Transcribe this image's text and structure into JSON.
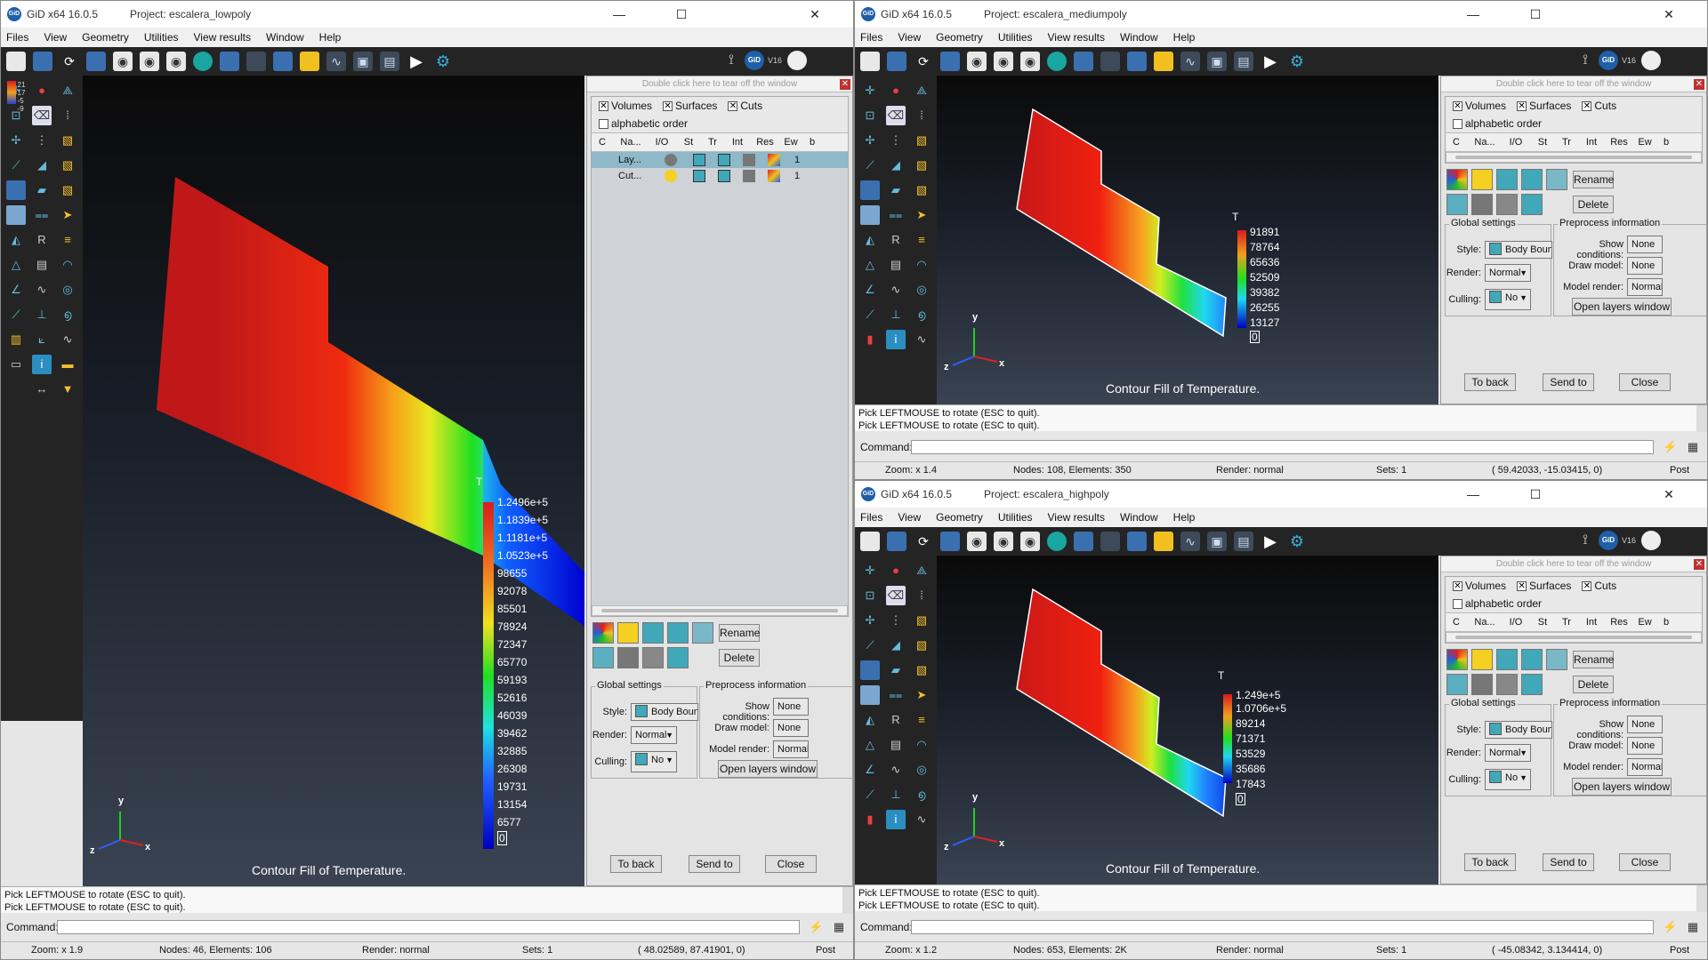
{
  "app_name": "GiD x64 16.0.5",
  "window_controls": {
    "minimize": "—",
    "maximize": "☐",
    "close": "✕"
  },
  "menu": [
    "Files",
    "View",
    "Geometry",
    "Utilities",
    "View results",
    "Window",
    "Help"
  ],
  "gid_badge": "GiD",
  "gid_version": "V16",
  "layers_panel": {
    "tear_text": "Double click here to tear off the window",
    "close_x": "✕",
    "checks": {
      "volumes": "Volumes",
      "surfaces": "Surfaces",
      "cuts": "Cuts",
      "alphabetic": "alphabetic order"
    },
    "columns": [
      "C",
      "Na...",
      "I/O",
      "St",
      "Tr",
      "Int",
      "Res",
      "Ew",
      "b"
    ],
    "rows_lowpoly": [
      {
        "name": "Lay...",
        "value": "1"
      },
      {
        "name": "Cut...",
        "value": "1"
      }
    ],
    "rename": "Rename",
    "delete": "Delete",
    "global_settings": "Global settings",
    "preprocess_info": "Preprocess information",
    "style_label": "Style:",
    "style_value": "Body Bound",
    "render_label": "Render:",
    "render_value": "Normal",
    "culling_label": "Culling:",
    "culling_value": "No",
    "show_conditions_label": "Show conditions:",
    "show_conditions_value": "None",
    "draw_model_label": "Draw model:",
    "draw_model_value": "None",
    "model_render_label": "Model render:",
    "model_render_value": "Normal",
    "open_layers": "Open layers window",
    "to_back": "To back",
    "send_to": "Send to",
    "close": "Close"
  },
  "status_lines": [
    "Pick LEFTMOUSE to rotate (ESC to quit).",
    "Pick LEFTMOUSE to rotate (ESC to quit)."
  ],
  "command_label": "Command:",
  "contour_label": "Contour Fill of Temperature.",
  "axis_labels": {
    "x": "x",
    "y": "y",
    "z": "z"
  },
  "windows": {
    "lowpoly": {
      "project": "Project: escalera_lowpoly",
      "legend_title": "T",
      "legend_values": [
        "1.2496e+5",
        "1.1839e+5",
        "1.1181e+5",
        "1.0523e+5",
        "98655",
        "92078",
        "85501",
        "78924",
        "72347",
        "65770",
        "59193",
        "52616",
        "46039",
        "39462",
        "32885",
        "26308",
        "19731",
        "13154",
        "6577",
        "0"
      ],
      "statusbar": {
        "zoom": "Zoom: x 1.9",
        "nodes": "Nodes: 46, Elements: 106",
        "render": "Render: normal",
        "sets": "Sets: 1",
        "coords": "( 48.02589, 87.41901, 0)",
        "mode": "Post"
      }
    },
    "mediumpoly": {
      "project": "Project: escalera_mediumpoly",
      "legend_title": "T",
      "legend_values": [
        "91891",
        "78764",
        "65636",
        "52509",
        "39382",
        "26255",
        "13127",
        "0"
      ],
      "statusbar": {
        "zoom": "Zoom: x 1.4",
        "nodes": "Nodes: 108, Elements: 350",
        "render": "Render: normal",
        "sets": "Sets: 1",
        "coords": "( 59.42033, -15.03415, 0)",
        "mode": "Post"
      }
    },
    "highpoly": {
      "project": "Project: escalera_highpoly",
      "legend_title": "T",
      "legend_values": [
        "1.249e+5",
        "1.0706e+5",
        "89214",
        "71371",
        "53529",
        "35686",
        "17843",
        "0"
      ],
      "statusbar": {
        "zoom": "Zoom: x 1.2",
        "nodes": "Nodes: 653, Elements: 2K",
        "render": "Render: normal",
        "sets": "Sets: 1",
        "coords": "( -45.08342, 3.134414, 0)",
        "mode": "Post"
      }
    }
  },
  "side_legend": [
    "21",
    "17",
    "-5",
    "-9"
  ],
  "colors": {
    "hot": "#d81c1c",
    "mid": "#20e020",
    "cold": "#0000d0",
    "accent": "#1aa6a0"
  }
}
